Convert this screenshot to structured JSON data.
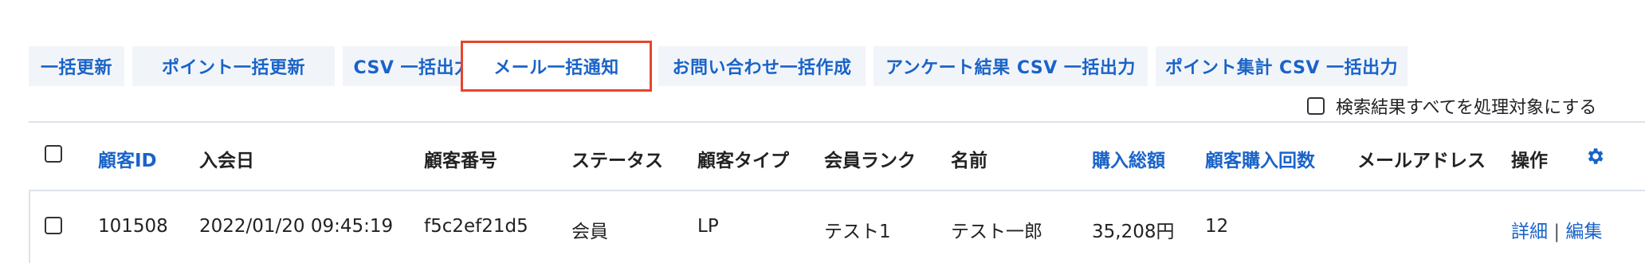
{
  "toolbar": {
    "buttons": [
      {
        "label": "一括更新"
      },
      {
        "label": "ポイント一括更新"
      },
      {
        "label": "CSV 一括出力"
      },
      {
        "label": "メール一括通知"
      },
      {
        "label": "お問い合わせ一括作成"
      },
      {
        "label": "アンケート結果 CSV 一括出力"
      },
      {
        "label": "ポイント集計 CSV 一括出力"
      }
    ]
  },
  "select_all": {
    "label": "検索結果すべてを処理対象にする"
  },
  "table": {
    "headers": {
      "customer_id": "顧客ID",
      "join_date": "入会日",
      "customer_number": "顧客番号",
      "status": "ステータス",
      "customer_type": "顧客タイプ",
      "member_rank": "会員ランク",
      "name": "名前",
      "total_purchase": "購入総額",
      "purchase_count": "顧客購入回数",
      "email": "メールアドレス",
      "actions": "操作"
    },
    "rows": [
      {
        "customer_id": "101508",
        "join_date": "2022/01/20 09:45:19",
        "customer_number": "f5c2ef21d5",
        "status": "会員",
        "customer_type": "LP",
        "member_rank": "テスト1",
        "name": "テスト一郎",
        "total_purchase": "35,208円",
        "purchase_count": "12",
        "email": "",
        "detail_link": "詳細",
        "separator": "|",
        "edit_link": "編集"
      }
    ]
  },
  "colors": {
    "accent": "#1a63c8",
    "highlight_border": "#e5452c",
    "button_bg": "#f1f5f9"
  }
}
